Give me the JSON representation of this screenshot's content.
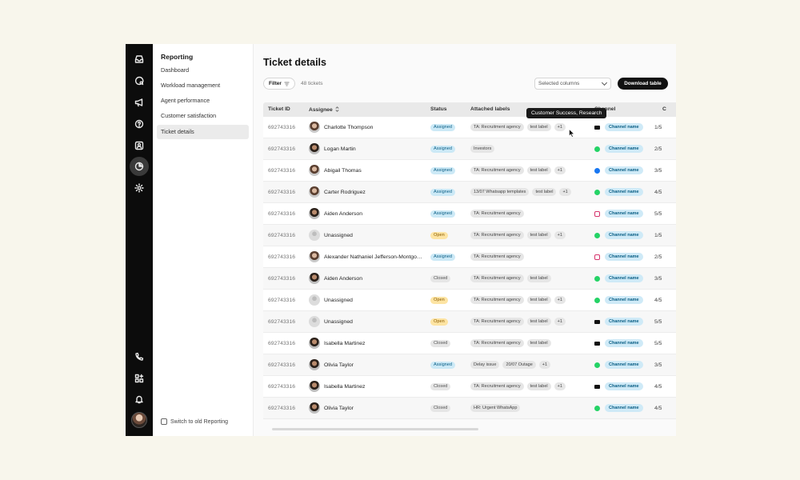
{
  "rail": {
    "icons": [
      "inbox-icon",
      "chat-search-icon",
      "megaphone-icon",
      "help-circle-icon",
      "contact-card-icon",
      "reporting-pie-icon",
      "settings-gear-icon",
      "phone-icon",
      "apps-grid-icon",
      "bell-icon"
    ],
    "active": "reporting-pie-icon"
  },
  "subnav": {
    "title": "Reporting",
    "items": [
      {
        "label": "Dashboard",
        "active": false
      },
      {
        "label": "Workload management",
        "active": false
      },
      {
        "label": "Agent performance",
        "active": false
      },
      {
        "label": "Customer satisfaction",
        "active": false
      },
      {
        "label": "Ticket details",
        "active": true
      }
    ],
    "switch_label": "Switch to old Reporting"
  },
  "page": {
    "title": "Ticket details",
    "filter_label": "Filter",
    "ticket_count": "48 tickets",
    "select_columns": "Selected columns",
    "download_label": "Download table"
  },
  "table": {
    "headers": {
      "id": "Ticket ID",
      "assignee": "Assignee",
      "status": "Status",
      "labels": "Attached labels",
      "channel": "Channel",
      "ratio": "C"
    },
    "rows": [
      {
        "id": "692743316",
        "assignee": "Charlotte Thompson",
        "avatar": "photo",
        "status": "Assigned",
        "labels": [
          "TA: Recruitment agency",
          "test label",
          "+1"
        ],
        "channel": "mail",
        "channel_name": "Channel name",
        "ratio": "1/5"
      },
      {
        "id": "692743316",
        "assignee": "Logan Martin",
        "avatar": "photo2",
        "status": "Assigned",
        "labels": [
          "Investors"
        ],
        "channel": "whatsapp",
        "channel_name": "Channel name",
        "ratio": "2/5"
      },
      {
        "id": "692743316",
        "assignee": "Abigail Thomas",
        "avatar": "photo",
        "status": "Assigned",
        "labels": [
          "TA: Recruitment agency",
          "test label",
          "+1"
        ],
        "channel": "facebook",
        "channel_name": "Channel name",
        "ratio": "3/5"
      },
      {
        "id": "692743316",
        "assignee": "Carter Rodriguez",
        "avatar": "photo",
        "status": "Assigned",
        "labels": [
          "13/07 Whatsapp templates",
          "test label",
          "+1"
        ],
        "channel": "whatsapp",
        "channel_name": "Channel name",
        "ratio": "4/5"
      },
      {
        "id": "692743316",
        "assignee": "Aiden Anderson",
        "avatar": "photo2",
        "status": "Assigned",
        "labels": [
          "TA: Recruitment agency"
        ],
        "channel": "instagram",
        "channel_name": "Channel name",
        "ratio": "5/5"
      },
      {
        "id": "692743316",
        "assignee": "Unassigned",
        "avatar": "placeholder",
        "status": "Open",
        "labels": [
          "TA: Recruitment agency",
          "test label",
          "+1"
        ],
        "channel": "whatsapp",
        "channel_name": "Channel name",
        "ratio": "1/5"
      },
      {
        "id": "692743316",
        "assignee": "Alexander Nathaniel Jefferson-Montgomery",
        "avatar": "photo",
        "status": "Assigned",
        "labels": [
          "TA: Recruitment agency"
        ],
        "channel": "instagram",
        "channel_name": "Channel name",
        "ratio": "2/5"
      },
      {
        "id": "692743316",
        "assignee": "Aiden Anderson",
        "avatar": "photo2",
        "status": "Closed",
        "labels": [
          "TA: Recruitment agency",
          "test label"
        ],
        "channel": "whatsapp",
        "channel_name": "Channel name",
        "ratio": "3/5"
      },
      {
        "id": "692743316",
        "assignee": "Unassigned",
        "avatar": "placeholder",
        "status": "Open",
        "labels": [
          "TA: Recruitment agency",
          "test label",
          "+1"
        ],
        "channel": "whatsapp",
        "channel_name": "Channel name",
        "ratio": "4/5"
      },
      {
        "id": "692743316",
        "assignee": "Unassigned",
        "avatar": "placeholder",
        "status": "Open",
        "labels": [
          "TA: Recruitment agency",
          "test label",
          "+1"
        ],
        "channel": "mail",
        "channel_name": "Channel name",
        "ratio": "5/5"
      },
      {
        "id": "692743316",
        "assignee": "Isabella Martinez",
        "avatar": "photo2",
        "status": "Closed",
        "labels": [
          "TA: Recruitment agency",
          "test label"
        ],
        "channel": "mail",
        "channel_name": "Channel name",
        "ratio": "5/5"
      },
      {
        "id": "692743316",
        "assignee": "Olivia Taylor",
        "avatar": "photo2",
        "status": "Assigned",
        "labels": [
          "Delay issue",
          "20/07 Outage",
          "+1"
        ],
        "channel": "whatsapp",
        "channel_name": "Channel name",
        "ratio": "3/5"
      },
      {
        "id": "692743316",
        "assignee": "Isabella Martinez",
        "avatar": "photo2",
        "status": "Closed",
        "labels": [
          "TA: Recruitment agency",
          "test label",
          "+1"
        ],
        "channel": "mail",
        "channel_name": "Channel name",
        "ratio": "4/5"
      },
      {
        "id": "692743316",
        "assignee": "Olivia Taylor",
        "avatar": "photo2",
        "status": "Closed",
        "labels": [
          "HR: Urgent WhatsApp"
        ],
        "channel": "whatsapp",
        "channel_name": "Channel name",
        "ratio": "4/5"
      }
    ]
  },
  "tooltip": "Customer Success, Research"
}
